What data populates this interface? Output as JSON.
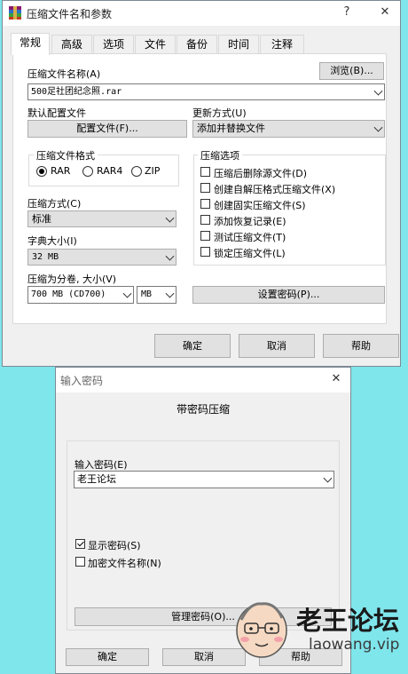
{
  "main_dialog": {
    "title": "压缩文件名和参数",
    "help_glyph": "?",
    "close_glyph": "✕",
    "tabs": [
      {
        "label": "常规",
        "active": true
      },
      {
        "label": "高级"
      },
      {
        "label": "选项"
      },
      {
        "label": "文件"
      },
      {
        "label": "备份"
      },
      {
        "label": "时间"
      },
      {
        "label": "注释"
      }
    ],
    "archive_name_label": "压缩文件名称(A)",
    "browse_button": "浏览(B)...",
    "archive_name_value": "500足社团纪念照.rar",
    "default_profile_label": "默认配置文件",
    "profile_button": "配置文件(F)...",
    "update_mode_label": "更新方式(U)",
    "update_mode_value": "添加并替换文件",
    "format_group_label": "压缩文件格式",
    "formats": [
      {
        "label": "RAR",
        "selected": true
      },
      {
        "label": "RAR4",
        "selected": false
      },
      {
        "label": "ZIP",
        "selected": false
      }
    ],
    "compression_method_label": "压缩方式(C)",
    "compression_method_value": "标准",
    "dictionary_size_label": "字典大小(I)",
    "dictionary_size_value": "32 MB",
    "split_volume_label": "压缩为分卷, 大小(V)",
    "split_volume_value": "700 MB  (CD700)",
    "split_unit_value": "MB",
    "options_group_label": "压缩选项",
    "options": [
      {
        "label": "压缩后删除源文件(D)",
        "checked": false
      },
      {
        "label": "创建自解压格式压缩文件(X)",
        "checked": false
      },
      {
        "label": "创建固实压缩文件(S)",
        "checked": false
      },
      {
        "label": "添加恢复记录(E)",
        "checked": false
      },
      {
        "label": "测试压缩文件(T)",
        "checked": false
      },
      {
        "label": "锁定压缩文件(L)",
        "checked": false
      }
    ],
    "set_password_button": "设置密码(P)...",
    "ok_button": "确定",
    "cancel_button": "取消",
    "help_button": "帮助"
  },
  "password_dialog": {
    "title": "输入密码",
    "close_glyph": "✕",
    "heading": "带密码压缩",
    "password_label": "输入密码(E)",
    "password_value": "老王论坛",
    "show_password_label": "显示密码(S)",
    "show_password_checked": true,
    "encrypt_names_label": "加密文件名称(N)",
    "encrypt_names_checked": false,
    "manage_button": "管理密码(O)...",
    "ok_button": "确定",
    "cancel_button": "取消",
    "help_button": "帮助"
  },
  "watermark": {
    "title": "老王论坛",
    "url": "laowang.vip"
  },
  "colors": {
    "background": "#7fe6ec",
    "dialog": "#f0f0f0",
    "panel": "#ffffff",
    "button": "#e1e1e1"
  }
}
